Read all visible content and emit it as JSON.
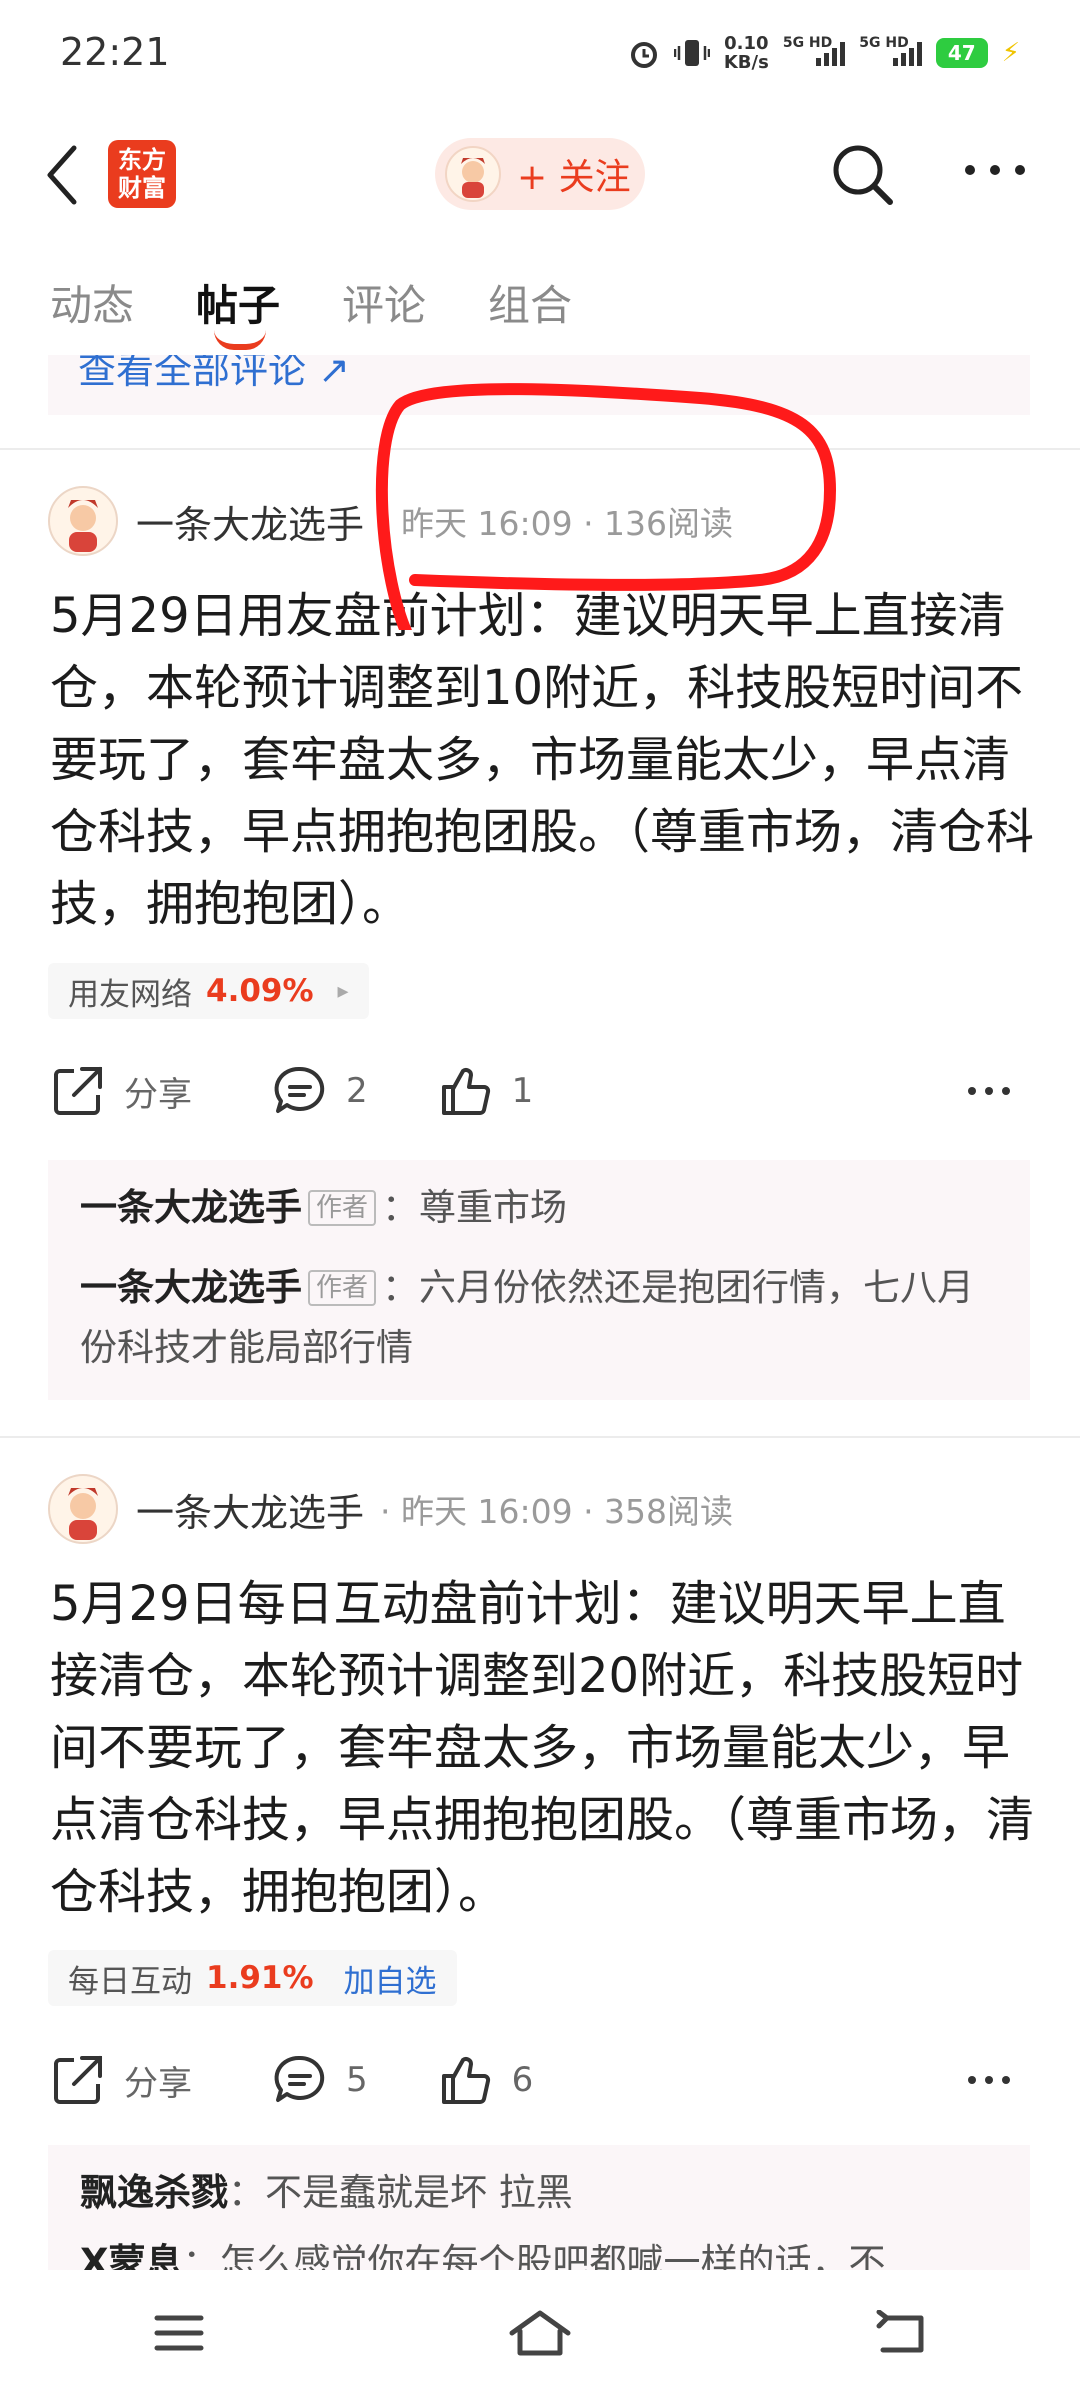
{
  "status_bar": {
    "time": "22:21",
    "net_speed": "0.10",
    "net_unit": "KB/s",
    "sim1": "5G HD",
    "sim2": "5G HD",
    "battery": "47"
  },
  "header": {
    "logo_line1": "东方",
    "logo_line2": "财富",
    "follow_label": "+ 关注"
  },
  "tabs": [
    {
      "label": "动态",
      "active": false
    },
    {
      "label": "帖子",
      "active": true
    },
    {
      "label": "评论",
      "active": false
    },
    {
      "label": "组合",
      "active": false
    }
  ],
  "prior_card": {
    "link_text": "查看全部评论 ↗"
  },
  "posts": [
    {
      "author": "一条大龙选手",
      "meta": "· 昨天 16:09 · 136阅读",
      "body": "5月29日用友盘前计划：建议明天早上直接清仓，本轮预计调整到10附近，科技股短时间不要玩了，套牢盘太多，市场量能太少，早点清仓科技，早点拥抱抱团股。（尊重市场，清仓科技，拥抱抱团）。",
      "stock": {
        "name": "用友网络",
        "change": "4.09%",
        "extra": "▸"
      },
      "actions": {
        "share": "分享",
        "comments": "2",
        "likes": "1"
      },
      "replies": [
        {
          "name": "一条大龙选手",
          "badge": "作者",
          "text": "：尊重市场"
        },
        {
          "name": "一条大龙选手",
          "badge": "作者",
          "text": "：六月份依然还是抱团行情，七八月份科技才能局部行情"
        }
      ]
    },
    {
      "author": "一条大龙选手",
      "meta": "· 昨天 16:09 · 358阅读",
      "body": "5月29日每日互动盘前计划：建议明天早上直接清仓，本轮预计调整到20附近，科技股短时间不要玩了，套牢盘太多，市场量能太少，早点清仓科技，早点拥抱抱团股。（尊重市场，清仓科技，拥抱抱团）。",
      "stock": {
        "name": "每日互动",
        "change": "1.91%",
        "extra": "加自选"
      },
      "actions": {
        "share": "分享",
        "comments": "5",
        "likes": "6"
      },
      "replies": [
        {
          "name": "飘逸杀戮",
          "badge": "",
          "text": "：不是蠢就是坏 拉黑"
        },
        {
          "name": "X蒙息",
          "badge": "",
          "text": "：怎么感觉你在每个股吧都喊一样的话，不"
        }
      ]
    }
  ],
  "colors": {
    "accent": "#ea3c1e",
    "link": "#2f6fd1",
    "annotation": "#ff1a1a"
  },
  "nav_icons": [
    "menu-icon",
    "home-icon",
    "back-nav-icon"
  ]
}
